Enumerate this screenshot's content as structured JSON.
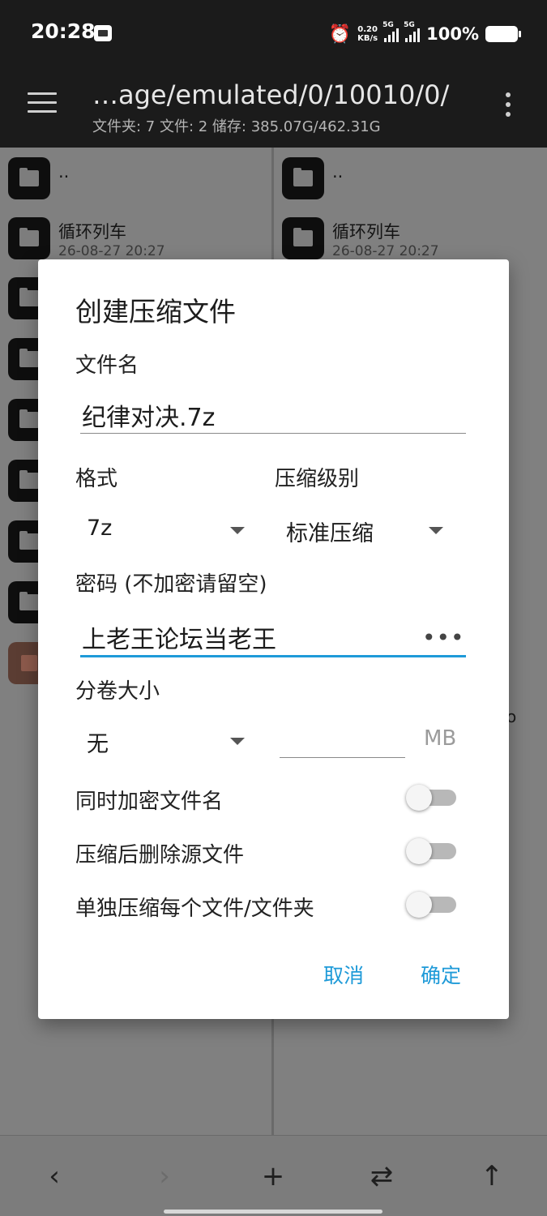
{
  "status_bar": {
    "time": "20:28",
    "speed_value": "0.20",
    "speed_unit": "KB/s",
    "network1": "5G",
    "network2": "5G",
    "battery": "100%"
  },
  "app_bar": {
    "path": "…age/emulated/0/10010/0/",
    "summary": "文件夹: 7   文件: 2   储存: 385.07G/462.31G"
  },
  "left_pane": {
    "rows": [
      {
        "name": "..",
        "date": ""
      },
      {
        "name": "循环列车",
        "date": "26-08-27 20:27"
      }
    ]
  },
  "right_pane": {
    "rows": [
      {
        "name": "..",
        "date": ""
      },
      {
        "name": "循环列车",
        "date": "26-08-27 20:27"
      }
    ],
    "stub_text": "o"
  },
  "dialog": {
    "title": "创建压缩文件",
    "filename_label": "文件名",
    "filename_value": "纪律对决.7z",
    "format_label": "格式",
    "format_value": "7z",
    "level_label": "压缩级别",
    "level_value": "标准压缩",
    "password_label": "密码 (不加密请留空)",
    "password_value": "上老王论坛当老王",
    "password_toggle": "•••",
    "volume_label": "分卷大小",
    "volume_value": "无",
    "volume_size_value": "",
    "volume_unit": "MB",
    "options": [
      {
        "label": "同时加密文件名",
        "enabled": false
      },
      {
        "label": "压缩后删除源文件",
        "enabled": false
      },
      {
        "label": "单独压缩每个文件/文件夹",
        "enabled": false
      }
    ],
    "cancel_label": "取消",
    "ok_label": "确定",
    "accent_color": "#1e9ad8"
  },
  "bottom_bar": {
    "back_icon": "‹",
    "forward_icon": "›",
    "add_icon": "+",
    "swap_icon": "⇄",
    "up_icon": "↑"
  }
}
